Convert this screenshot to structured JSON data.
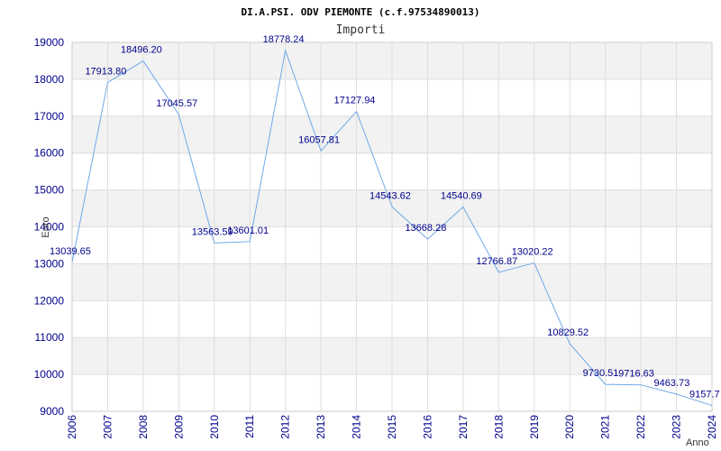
{
  "chart_data": {
    "type": "line",
    "title": "DI.A.PSI. ODV PIEMONTE (c.f.97534890013)",
    "subtitle": "Importi",
    "xlabel": "Anno",
    "ylabel": "Euro",
    "x": [
      "2006",
      "2007",
      "2008",
      "2009",
      "2010",
      "2011",
      "2012",
      "2013",
      "2014",
      "2015",
      "2016",
      "2017",
      "2018",
      "2019",
      "2020",
      "2021",
      "2022",
      "2023",
      "2024"
    ],
    "series": [
      {
        "values": [
          13039.65,
          17913.8,
          18496.2,
          17045.57,
          13563.59,
          13601.01,
          18778.24,
          16057.81,
          17127.94,
          14543.62,
          13668.28,
          14540.69,
          12766.87,
          13020.22,
          10829.52,
          9730.51,
          9716.63,
          9463.73,
          9157.7
        ],
        "labels": [
          "13039.65",
          "17913.80",
          "18496.20",
          "17045.57",
          "13563.59",
          "13601.01",
          "18778.24",
          "16057.81",
          "17127.94",
          "14543.62",
          "13668.28",
          "14540.69",
          "12766.87",
          "13020.22",
          "10829.52",
          "9730.51",
          "9716.63",
          "9463.73",
          "9157.7"
        ]
      }
    ],
    "y_ticks": [
      "9000",
      "10000",
      "11000",
      "12000",
      "13000",
      "14000",
      "15000",
      "16000",
      "17000",
      "18000",
      "19000"
    ],
    "ylim": [
      9000,
      19000
    ],
    "grid": "horizontal bands",
    "colors": {
      "line": "#6fa8e8",
      "band": "#f2f2f2",
      "grid": "#dddddd",
      "tick_text": "#00008b",
      "label_text": "#00008b"
    }
  }
}
